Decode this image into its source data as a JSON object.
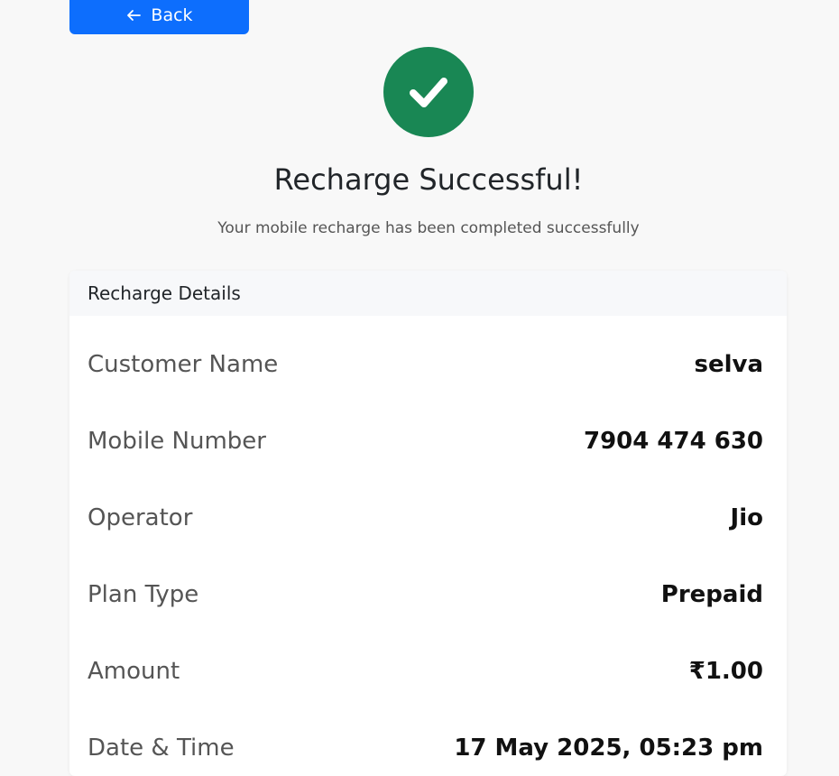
{
  "back_button": {
    "label": "Back"
  },
  "success": {
    "title": "Recharge Successful!",
    "subtitle": "Your mobile recharge has been completed successfully",
    "icon_color": "#198754"
  },
  "card": {
    "header": "Recharge Details",
    "rows": [
      {
        "label": "Customer Name",
        "value": "selva"
      },
      {
        "label": "Mobile Number",
        "value": "7904 474 630"
      },
      {
        "label": "Operator",
        "value": "Jio"
      },
      {
        "label": "Plan Type",
        "value": "Prepaid"
      },
      {
        "label": "Amount",
        "value": "₹1.00"
      },
      {
        "label": "Date & Time",
        "value": "17 May 2025, 05:23 pm"
      }
    ]
  },
  "colors": {
    "primary": "#0d6efd",
    "success": "#198754",
    "background": "#f8f8f8"
  }
}
